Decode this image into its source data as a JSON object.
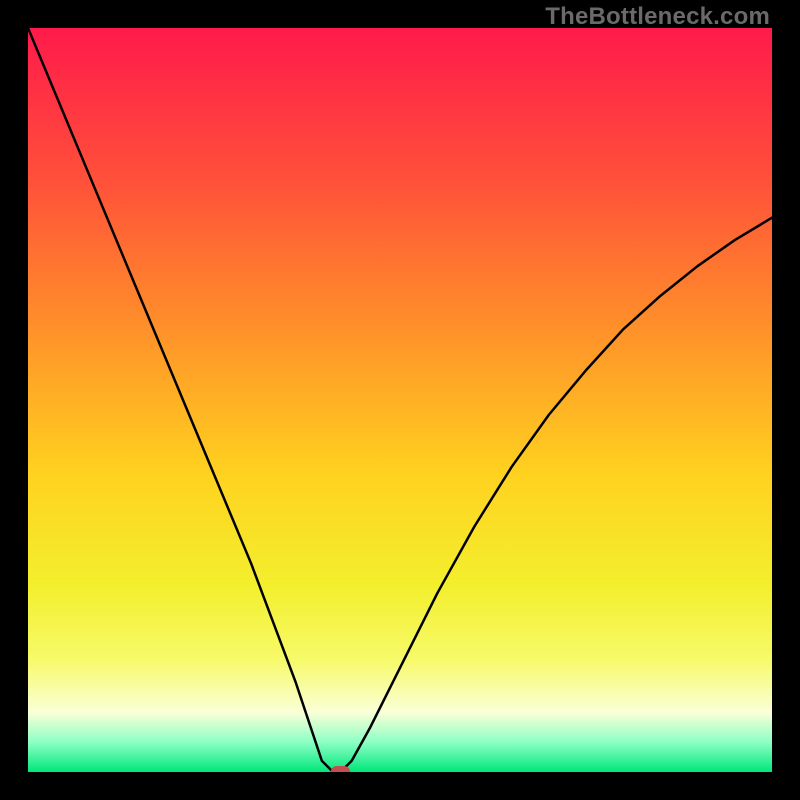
{
  "watermark": "TheBottleneck.com",
  "chart_data": {
    "type": "line",
    "title": "",
    "xlabel": "",
    "ylabel": "",
    "xlim": [
      0,
      100
    ],
    "ylim": [
      0,
      100
    ],
    "grid": false,
    "legend": false,
    "background": {
      "type": "vertical-gradient",
      "stops": [
        {
          "offset": 0.0,
          "color": "#ff1a4b"
        },
        {
          "offset": 0.2,
          "color": "#ff4f3a"
        },
        {
          "offset": 0.4,
          "color": "#ff8f2a"
        },
        {
          "offset": 0.6,
          "color": "#ffd21f"
        },
        {
          "offset": 0.75,
          "color": "#f3ef2d"
        },
        {
          "offset": 0.85,
          "color": "#f7fa6a"
        },
        {
          "offset": 0.92,
          "color": "#faffd8"
        },
        {
          "offset": 0.96,
          "color": "#8cffc4"
        },
        {
          "offset": 1.0,
          "color": "#00e77a"
        }
      ]
    },
    "series": [
      {
        "name": "curve",
        "stroke": "#000000",
        "stroke_width": 2.5,
        "x": [
          0,
          5,
          10,
          15,
          20,
          25,
          30,
          33,
          36,
          38,
          39.5,
          41,
          42,
          43.5,
          46,
          50,
          55,
          60,
          65,
          70,
          75,
          80,
          85,
          90,
          95,
          100
        ],
        "values": [
          100,
          88,
          76,
          64,
          52,
          40,
          28,
          20,
          12,
          6,
          1.5,
          0,
          0,
          1.5,
          6,
          14,
          24,
          33,
          41,
          48,
          54,
          59.5,
          64,
          68,
          71.5,
          74.5
        ]
      }
    ],
    "marker": {
      "name": "min-point",
      "shape": "rounded-rect",
      "x": 42,
      "y": 0,
      "width_pct": 2.6,
      "height_pct": 1.6,
      "fill": "#c24f4f"
    }
  }
}
